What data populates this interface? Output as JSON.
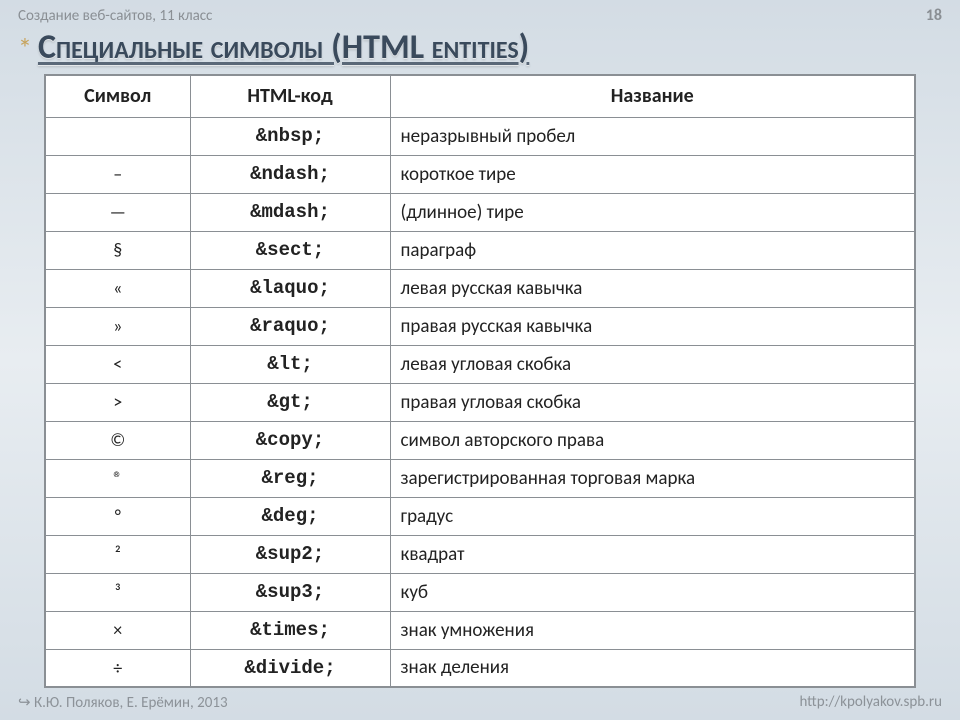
{
  "header": {
    "course": "Создание веб-сайтов, 11 класс",
    "page_number": "18"
  },
  "title": "Специальные символы (HTML entities)",
  "table": {
    "headers": {
      "symbol": "Символ",
      "code": "HTML-код",
      "name": "Название"
    },
    "rows": [
      {
        "symbol": " ",
        "code": "&nbsp;",
        "name": "неразрывный пробел"
      },
      {
        "symbol": "–",
        "code": "&ndash;",
        "name": "короткое тире"
      },
      {
        "symbol": "—",
        "code": "&mdash;",
        "name": "(длинное) тире"
      },
      {
        "symbol": "§",
        "code": "&sect;",
        "name": "параграф"
      },
      {
        "symbol": "«",
        "code": "&laquo;",
        "name": "левая русская кавычка"
      },
      {
        "symbol": "»",
        "code": "&raquo;",
        "name": "правая русская кавычка"
      },
      {
        "symbol": "<",
        "code": "&lt;",
        "name": "левая угловая скобка"
      },
      {
        "symbol": ">",
        "code": "&gt;",
        "name": "правая угловая скобка"
      },
      {
        "symbol": "©",
        "code": "&copy;",
        "name": "символ авторского права"
      },
      {
        "symbol": "®",
        "code": "&reg;",
        "name": "зарегистрированная торговая марка"
      },
      {
        "symbol": "°",
        "code": "&deg;",
        "name": "градус"
      },
      {
        "symbol": "²",
        "code": "&sup2;",
        "name": "квадрат"
      },
      {
        "symbol": "³",
        "code": "&sup3;",
        "name": "куб"
      },
      {
        "symbol": "×",
        "code": "&times;",
        "name": "знак умножения"
      },
      {
        "symbol": "÷",
        "code": "&divide;",
        "name": "знак деления"
      }
    ]
  },
  "footer": {
    "left": "↪ К.Ю. Поляков, Е. Ерёмин, 2013",
    "right": "http://kpolyakov.spb.ru"
  }
}
